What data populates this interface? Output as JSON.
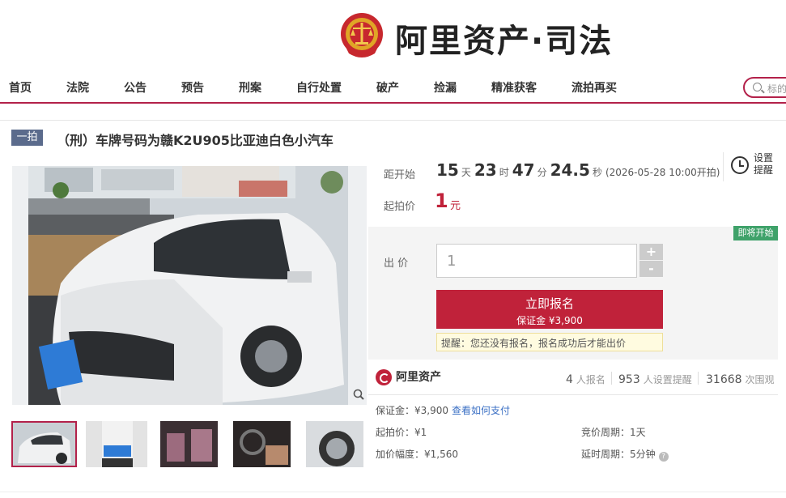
{
  "header": {
    "brand": "阿里资产·司法"
  },
  "nav": {
    "items": [
      "首页",
      "法院",
      "公告",
      "预告",
      "刑案",
      "自行处置",
      "破产",
      "捡漏",
      "精准获客",
      "流拍再买"
    ],
    "search_placeholder": "标的"
  },
  "lot": {
    "tag": "一拍",
    "title": "（刑）车牌号码为赣K2U905比亚迪白色小汽车",
    "plate_text": "赣K·2U905"
  },
  "countdown": {
    "label": "距开始",
    "days": "15",
    "days_unit": "天",
    "hours": "23",
    "hours_unit": "时",
    "minutes": "47",
    "minutes_unit": "分",
    "seconds": "24.5",
    "seconds_unit": "秒",
    "start_note": "(2026-05-28 10:00开拍)"
  },
  "starting_price": {
    "label": "起拍价",
    "value": "1",
    "unit": "元"
  },
  "reminder": {
    "label": "设置提醒"
  },
  "bid": {
    "status_badge": "即将开始",
    "label": "出 价",
    "input_value": "1",
    "plus": "+",
    "minus": "-",
    "signup_title": "立即报名",
    "signup_deposit": "保证金 ¥3,900",
    "tip": "提醒：您还没有报名，报名成功后才能出价"
  },
  "platform": {
    "name": "阿里资产"
  },
  "stats": {
    "signups": "4",
    "signups_unit": "人报名",
    "reminders": "953",
    "reminders_unit": "人设置提醒",
    "views": "31668",
    "views_unit": "次围观"
  },
  "details": {
    "deposit": "保证金：¥3,900",
    "how_to_pay": "查看如何支付",
    "start_price": "起拍价：¥1",
    "increment": "加价幅度：¥1,560",
    "bid_cycle": "竞价周期：1天",
    "delay_cycle": "延时周期：5分钟"
  },
  "colors": {
    "accent": "#c0223a",
    "nav_border": "#b3214a",
    "badge_green": "#3fa26a",
    "tag_bg": "#5b6b8c"
  },
  "icons": [
    "court-emblem-icon",
    "search-icon",
    "clock-icon",
    "zoom-icon",
    "help-icon",
    "alibaba-assets-logo-icon"
  ]
}
